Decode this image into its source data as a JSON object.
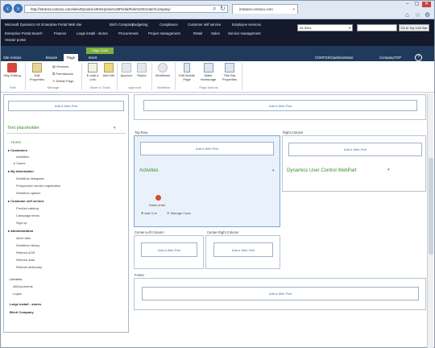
{
  "browser": {
    "url": "http://intranet.contoso.com/sites/Dynamics/Enterprise%20Portal/Role%20Center/Company/",
    "tab_title": "intranet.contoso.com",
    "window_buttons": [
      "–",
      "▢",
      "✕"
    ]
  },
  "topbar": {
    "site_title": "Microsoft Dynamics AX Enterprise Portal Web site",
    "top_links": [
      "Birch Company",
      "Budgeting",
      "Compliance",
      "Customer self service",
      "Employee services"
    ],
    "second_links": [
      "Enterprise Portal Search",
      "Finance",
      "Large install - stores",
      "Procurement",
      "Project management",
      "Retail",
      "Sales",
      "Service management"
    ],
    "third_links": [
      "Vendor portal"
    ],
    "search_scope": "All Sites",
    "go_top_link": "Go to Top Link Bar"
  },
  "ribbon": {
    "site_actions": "Site Actions",
    "tabs": {
      "browse": "Browse",
      "page": "Page",
      "insert": "Insert",
      "context": "Page Tools"
    },
    "user": "CONTOSO\\administrator",
    "company": "CompanyTOP",
    "commands": {
      "stop_editing": "Stop Editing",
      "edit_properties": "Edit Properties",
      "versions": "Versions",
      "permissions": "Permissions",
      "delete_page": "Delete Page",
      "email_link": "E-mail a Link",
      "alert_me": "Alert Me",
      "approve": "Approve",
      "reject": "Reject",
      "workflows": "Workflows",
      "edit_mobile_page": "Edit Mobile Page",
      "make_homepage": "Make Homepage",
      "title_bar_properties": "Title Bar Properties"
    },
    "groups": {
      "edit": "Edit",
      "manage": "Manage",
      "share": "Share & Track",
      "approval": "Approval",
      "workflow": "Workflow",
      "page_actions": "Page Actions"
    }
  },
  "left": {
    "add_web_part": "Add a Web Part",
    "placeholder_title": "Text placeholder",
    "home": "Home",
    "customers": "Customers",
    "activities": "Activities",
    "cases": "Cases",
    "my_information": "My information",
    "workflow_delegates": "Workflow delegates",
    "prospective_vendor": "Prospective vendor registration",
    "workflow_options": "Workflow options",
    "customer_self_service": "Customer self service",
    "product_catalog": "Product catalog",
    "campaign_items": "Campaign items",
    "sign_up": "Sign up",
    "administration": "Administration",
    "alert_rules": "Alert rules",
    "workflow_history": "Workflow history",
    "refresh_aod": "Refresh AOD",
    "refresh_data": "Refresh data",
    "refresh_dictionary": "Refresh dictionary",
    "libraries": "Libraries",
    "all_documents": "AllDocuments",
    "logos": "Logos",
    "large_install": "Large install - stores",
    "birch_company": "Birch Company"
  },
  "main": {
    "add_web_part": "Add a Web Part",
    "top_row": "Top Row",
    "right_column": "Right Column",
    "activities_title": "Activities",
    "sales_order": "Sales order",
    "add_cue": "Add Cue",
    "manage_cues": "Manage Cues",
    "dynamics_title": "Dynamics User Control WebPart",
    "center_left": "Center-Left Column",
    "center_right": "Center-Right Column",
    "footer": "Footer"
  }
}
